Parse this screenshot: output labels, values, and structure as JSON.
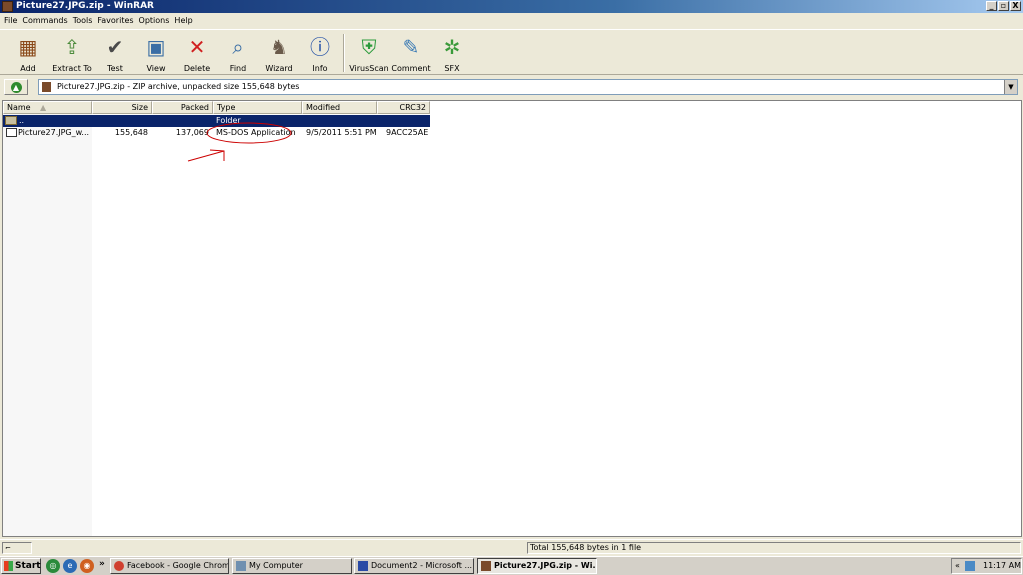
{
  "window": {
    "title": "Picture27.JPG.zip - WinRAR",
    "caption_buttons": [
      "_",
      "▫",
      "X"
    ]
  },
  "menu": [
    "File",
    "Commands",
    "Tools",
    "Favorites",
    "Options",
    "Help"
  ],
  "toolbar": [
    {
      "label": "Add",
      "icon": "add-archive-icon"
    },
    {
      "label": "Extract To",
      "icon": "extract-icon"
    },
    {
      "label": "Test",
      "icon": "test-icon"
    },
    {
      "label": "View",
      "icon": "view-icon"
    },
    {
      "label": "Delete",
      "icon": "delete-icon"
    },
    {
      "label": "Find",
      "icon": "find-icon"
    },
    {
      "label": "Wizard",
      "icon": "wizard-icon"
    },
    {
      "label": "Info",
      "icon": "info-icon"
    },
    {
      "label": "VirusScan",
      "icon": "virusscan-icon"
    },
    {
      "label": "Comment",
      "icon": "comment-icon"
    },
    {
      "label": "SFX",
      "icon": "sfx-icon"
    }
  ],
  "address": {
    "text": "Picture27.JPG.zip - ZIP archive, unpacked size 155,648 bytes"
  },
  "columns": [
    "Name",
    "Size",
    "Packed",
    "Type",
    "Modified",
    "CRC32"
  ],
  "rows": [
    {
      "name": "..",
      "size": "",
      "packed": "",
      "type": "Folder",
      "modified": "",
      "crc": ""
    },
    {
      "name": "Picture27.JPG_w...",
      "size": "155,648",
      "packed": "137,069",
      "type": "MS-DOS Application",
      "modified": "9/5/2011 5:51 PM",
      "crc": "9ACC25AE"
    }
  ],
  "status": {
    "text": "Total 155,648 bytes in 1 file"
  },
  "taskbar": {
    "start": "Start",
    "overflow": "»",
    "tasks": [
      "Facebook - Google Chrome",
      "My Computer",
      "Document2 - Microsoft ...",
      "Picture27.JPG.zip - Wi..."
    ],
    "tray_chevron": "«",
    "clock": "11:17 AM"
  },
  "colors": {
    "selection": "#0a246a",
    "annotation": "#cc0000",
    "titlebar": "#0a246a"
  }
}
